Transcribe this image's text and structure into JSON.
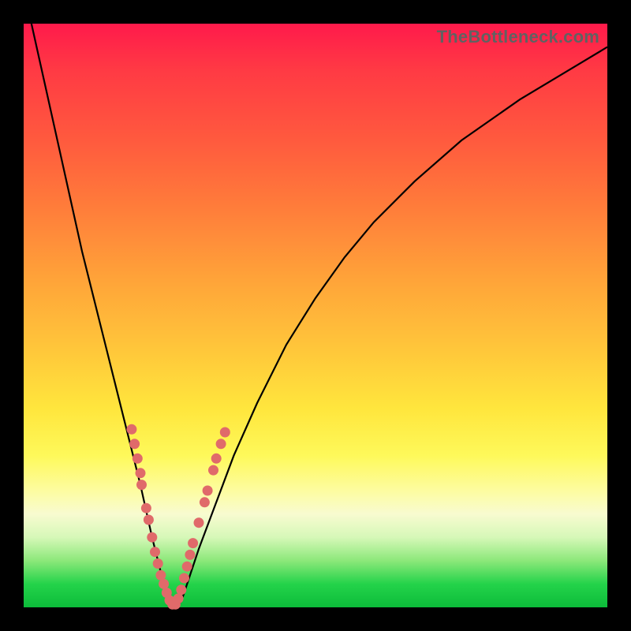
{
  "watermark": "TheBottleneck.com",
  "colors": {
    "gradient_top": "#ff1a4b",
    "gradient_bottom": "#0cbc3a",
    "curve": "#000000",
    "dots": "#e06a6a",
    "frame": "#000000"
  },
  "chart_data": {
    "type": "line",
    "title": "",
    "xlabel": "",
    "ylabel": "",
    "xlim": [
      0,
      100
    ],
    "ylim": [
      0,
      100
    ],
    "background_gradient_meaning": "bottleneck severity (green=low, red=high)",
    "series": [
      {
        "name": "bottleneck-curve",
        "x": [
          0,
          2,
          4,
          6,
          8,
          10,
          12,
          14,
          16,
          18,
          20,
          22,
          23,
          24,
          25,
          26,
          27,
          28,
          30,
          33,
          36,
          40,
          45,
          50,
          55,
          60,
          67,
          75,
          85,
          95,
          100
        ],
        "y": [
          106,
          97,
          88,
          79,
          70,
          61,
          53,
          45,
          37,
          29,
          21,
          12,
          8,
          4,
          1,
          0,
          1,
          4,
          10,
          18,
          26,
          35,
          45,
          53,
          60,
          66,
          73,
          80,
          87,
          93,
          96
        ]
      }
    ],
    "scatter": {
      "name": "highlighted-points",
      "points": [
        {
          "x": 18.5,
          "y": 30.5
        },
        {
          "x": 19.0,
          "y": 28.0
        },
        {
          "x": 19.5,
          "y": 25.5
        },
        {
          "x": 20.0,
          "y": 23.0
        },
        {
          "x": 20.2,
          "y": 21.0
        },
        {
          "x": 21.0,
          "y": 17.0
        },
        {
          "x": 21.4,
          "y": 15.0
        },
        {
          "x": 22.0,
          "y": 12.0
        },
        {
          "x": 22.5,
          "y": 9.5
        },
        {
          "x": 23.0,
          "y": 7.5
        },
        {
          "x": 23.5,
          "y": 5.5
        },
        {
          "x": 24.0,
          "y": 4.0
        },
        {
          "x": 24.5,
          "y": 2.5
        },
        {
          "x": 25.0,
          "y": 1.2
        },
        {
          "x": 25.5,
          "y": 0.5
        },
        {
          "x": 26.0,
          "y": 0.5
        },
        {
          "x": 26.5,
          "y": 1.5
        },
        {
          "x": 27.0,
          "y": 3.0
        },
        {
          "x": 27.5,
          "y": 5.0
        },
        {
          "x": 28.0,
          "y": 7.0
        },
        {
          "x": 28.5,
          "y": 9.0
        },
        {
          "x": 29.0,
          "y": 11.0
        },
        {
          "x": 30.0,
          "y": 14.5
        },
        {
          "x": 31.0,
          "y": 18.0
        },
        {
          "x": 31.5,
          "y": 20.0
        },
        {
          "x": 32.5,
          "y": 23.5
        },
        {
          "x": 33.0,
          "y": 25.5
        },
        {
          "x": 33.8,
          "y": 28.0
        },
        {
          "x": 34.5,
          "y": 30.0
        }
      ]
    }
  }
}
